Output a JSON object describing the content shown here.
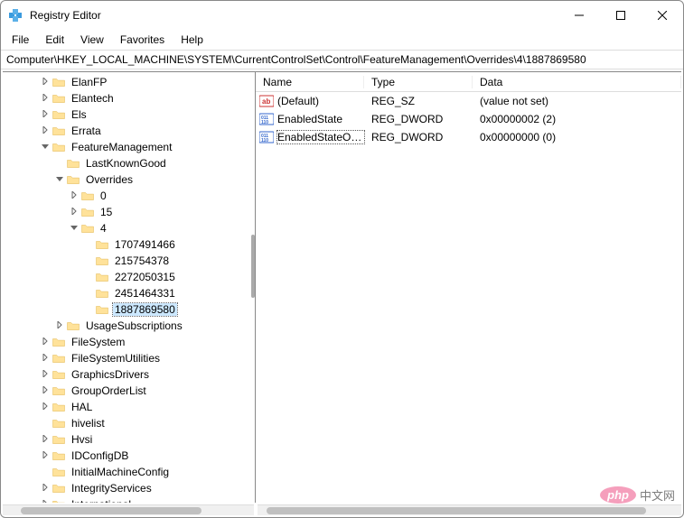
{
  "window": {
    "title": "Registry Editor"
  },
  "menu": {
    "file": "File",
    "edit": "Edit",
    "view": "View",
    "favorites": "Favorites",
    "help": "Help"
  },
  "address": "Computer\\HKEY_LOCAL_MACHINE\\SYSTEM\\CurrentControlSet\\Control\\FeatureManagement\\Overrides\\4\\1887869580",
  "columns": {
    "name": "Name",
    "type": "Type",
    "data": "Data"
  },
  "tree": {
    "items": [
      {
        "depth": 2,
        "exp": ">",
        "label": "ElanFP"
      },
      {
        "depth": 2,
        "exp": ">",
        "label": "Elantech"
      },
      {
        "depth": 2,
        "exp": ">",
        "label": "Els"
      },
      {
        "depth": 2,
        "exp": ">",
        "label": "Errata"
      },
      {
        "depth": 2,
        "exp": "v",
        "label": "FeatureManagement"
      },
      {
        "depth": 3,
        "exp": "",
        "label": "LastKnownGood"
      },
      {
        "depth": 3,
        "exp": "v",
        "label": "Overrides"
      },
      {
        "depth": 4,
        "exp": ">",
        "label": "0"
      },
      {
        "depth": 4,
        "exp": ">",
        "label": "15"
      },
      {
        "depth": 4,
        "exp": "v",
        "label": "4"
      },
      {
        "depth": 5,
        "exp": "",
        "label": "1707491466"
      },
      {
        "depth": 5,
        "exp": "",
        "label": "215754378"
      },
      {
        "depth": 5,
        "exp": "",
        "label": "2272050315"
      },
      {
        "depth": 5,
        "exp": "",
        "label": "2451464331"
      },
      {
        "depth": 5,
        "exp": "",
        "label": "1887869580",
        "selected": true
      },
      {
        "depth": 3,
        "exp": ">",
        "label": "UsageSubscriptions"
      },
      {
        "depth": 2,
        "exp": ">",
        "label": "FileSystem"
      },
      {
        "depth": 2,
        "exp": ">",
        "label": "FileSystemUtilities"
      },
      {
        "depth": 2,
        "exp": ">",
        "label": "GraphicsDrivers"
      },
      {
        "depth": 2,
        "exp": ">",
        "label": "GroupOrderList"
      },
      {
        "depth": 2,
        "exp": ">",
        "label": "HAL"
      },
      {
        "depth": 2,
        "exp": "",
        "label": "hivelist"
      },
      {
        "depth": 2,
        "exp": ">",
        "label": "Hvsi"
      },
      {
        "depth": 2,
        "exp": ">",
        "label": "IDConfigDB"
      },
      {
        "depth": 2,
        "exp": "",
        "label": "InitialMachineConfig"
      },
      {
        "depth": 2,
        "exp": ">",
        "label": "IntegrityServices"
      },
      {
        "depth": 2,
        "exp": ">",
        "label": "International"
      }
    ]
  },
  "values": [
    {
      "icon": "sz",
      "name": "(Default)",
      "type": "REG_SZ",
      "data": "(value not set)"
    },
    {
      "icon": "dw",
      "name": "EnabledState",
      "type": "REG_DWORD",
      "data": "0x00000002 (2)"
    },
    {
      "icon": "dw",
      "name": "EnabledStateOp...",
      "type": "REG_DWORD",
      "data": "0x00000000 (0)",
      "selected": true
    }
  ],
  "watermark": {
    "php": "php",
    "text": "中文网"
  }
}
